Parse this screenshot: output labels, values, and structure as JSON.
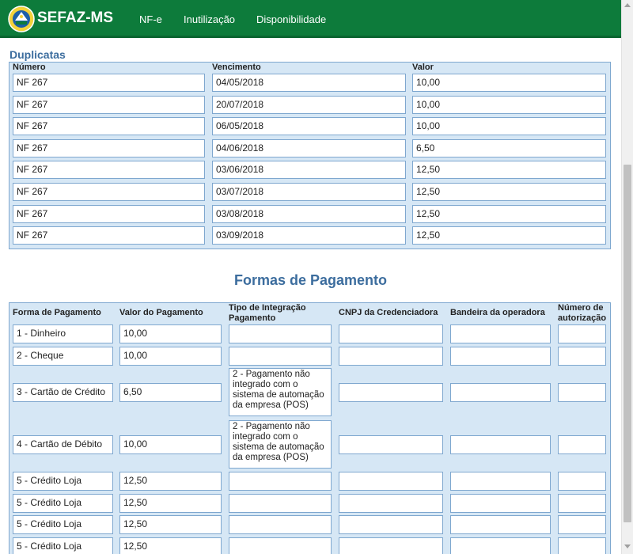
{
  "header": {
    "brand": "SEFAZ-MS",
    "nav": [
      "NF-e",
      "Inutilização",
      "Disponibilidade"
    ],
    "colors": {
      "header_bg": "#0d7b3b",
      "title_blue": "#3c6d9e",
      "panel_bg": "#d6e7f5"
    }
  },
  "duplicatas": {
    "title": "Duplicatas",
    "headers": [
      "Número",
      "Vencimento",
      "Valor"
    ],
    "rows": [
      [
        "NF 267",
        "04/05/2018",
        "10,00"
      ],
      [
        "NF 267",
        "20/07/2018",
        "10,00"
      ],
      [
        "NF 267",
        "06/05/2018",
        "10,00"
      ],
      [
        "NF 267",
        "04/06/2018",
        "6,50"
      ],
      [
        "NF 267",
        "03/06/2018",
        "12,50"
      ],
      [
        "NF 267",
        "03/07/2018",
        "12,50"
      ],
      [
        "NF 267",
        "03/08/2018",
        "12,50"
      ],
      [
        "NF 267",
        "03/09/2018",
        "12,50"
      ]
    ]
  },
  "pagamento": {
    "title": "Formas de Pagamento",
    "headers": [
      "Forma de Pagamento",
      "Valor do Pagamento",
      "Tipo de Integração Pagamento",
      "CNPJ da Credenciadora",
      "Bandeira da operadora",
      "Número de autorização"
    ],
    "rows": [
      [
        "1 - Dinheiro",
        "10,00",
        "",
        "",
        "",
        ""
      ],
      [
        "2 - Cheque",
        "10,00",
        "",
        "",
        "",
        ""
      ],
      [
        "3 - Cartão de Crédito",
        "6,50",
        "2 - Pagamento não integrado com o sistema de automação da empresa (POS)",
        "",
        "",
        ""
      ],
      [
        "4 - Cartão de Débito",
        "10,00",
        "2 - Pagamento não integrado com o sistema de automação da empresa (POS)",
        "",
        "",
        ""
      ],
      [
        "5 - Crédito Loja",
        "12,50",
        "",
        "",
        "",
        ""
      ],
      [
        "5 - Crédito Loja",
        "12,50",
        "",
        "",
        "",
        ""
      ],
      [
        "5 - Crédito Loja",
        "12,50",
        "",
        "",
        "",
        ""
      ],
      [
        "5 - Crédito Loja",
        "12,50",
        "",
        "",
        "",
        ""
      ]
    ]
  }
}
